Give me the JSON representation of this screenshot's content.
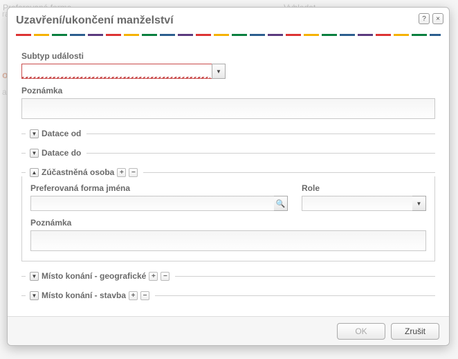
{
  "background": {
    "pref_label": "Preferovaná forma",
    "vyhledat": "Vyhledat",
    "orange_fragment": "ob",
    "gray_fragment1": "rac",
    "gray_fragment2": "anc"
  },
  "dialog": {
    "title": "Uzavření/ukončení manželství",
    "help_tip": "?",
    "close_tip": "×"
  },
  "fields": {
    "subtype_label": "Subtyp události",
    "subtype_value": "",
    "note_label": "Poznámka",
    "note_value": ""
  },
  "sections": {
    "date_from": {
      "legend": "Datace od",
      "expanded": false
    },
    "date_to": {
      "legend": "Datace do",
      "expanded": false
    },
    "person": {
      "legend": "Zúčastněná osoba",
      "expanded": true,
      "pref_name_label": "Preferovaná forma jména",
      "pref_name_value": "",
      "role_label": "Role",
      "role_value": "",
      "note_label": "Poznámka",
      "note_value": ""
    },
    "place_geo": {
      "legend": "Místo konání - geografické",
      "expanded": false
    },
    "place_bldg": {
      "legend": "Místo konání - stavba",
      "expanded": false
    }
  },
  "footer": {
    "ok": "OK",
    "cancel": "Zrušit"
  },
  "glyphs": {
    "chev_down": "▼",
    "chev_up": "▲",
    "plus": "+",
    "minus": "−",
    "search": "🔍"
  }
}
